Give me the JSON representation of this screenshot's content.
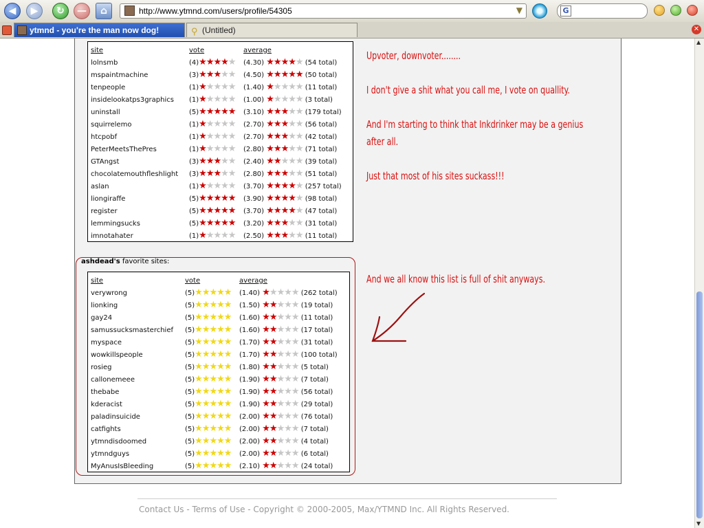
{
  "browser": {
    "url": "http://www.ytmnd.com/users/profile/54305",
    "tabs": [
      {
        "label": "ytmnd - you're the man now dog!",
        "active": true
      },
      {
        "label": "(Untitled)",
        "active": false
      }
    ],
    "search_engine_icon": "G"
  },
  "votes_table": {
    "headers": {
      "site": "site",
      "vote": "vote",
      "average": "average"
    },
    "rows": [
      {
        "site": "lolnsmb",
        "vote": 4,
        "vote_label": "(4)",
        "average": 4.3,
        "average_label": "(4.30)",
        "total": "(54 total)"
      },
      {
        "site": "mspaintmachine",
        "vote": 3,
        "vote_label": "(3)",
        "average": 4.5,
        "average_label": "(4.50)",
        "total": "(50 total)"
      },
      {
        "site": "tenpeople",
        "vote": 1,
        "vote_label": "(1)",
        "average": 1.4,
        "average_label": "(1.40)",
        "total": "(11 total)"
      },
      {
        "site": "insidelookatps3graphics",
        "vote": 1,
        "vote_label": "(1)",
        "average": 1.0,
        "average_label": "(1.00)",
        "total": "(3 total)"
      },
      {
        "site": "uninstall",
        "vote": 5,
        "vote_label": "(5)",
        "average": 3.1,
        "average_label": "(3.10)",
        "total": "(179 total)"
      },
      {
        "site": "squirrelemo",
        "vote": 1,
        "vote_label": "(1)",
        "average": 2.7,
        "average_label": "(2.70)",
        "total": "(56 total)"
      },
      {
        "site": "htcpobf",
        "vote": 1,
        "vote_label": "(1)",
        "average": 2.7,
        "average_label": "(2.70)",
        "total": "(42 total)"
      },
      {
        "site": "PeterMeetsThePres",
        "vote": 1,
        "vote_label": "(1)",
        "average": 2.8,
        "average_label": "(2.80)",
        "total": "(71 total)"
      },
      {
        "site": "GTAngst",
        "vote": 3,
        "vote_label": "(3)",
        "average": 2.4,
        "average_label": "(2.40)",
        "total": "(39 total)"
      },
      {
        "site": "chocolatemouthfleshlight",
        "vote": 3,
        "vote_label": "(3)",
        "average": 2.8,
        "average_label": "(2.80)",
        "total": "(51 total)"
      },
      {
        "site": "aslan",
        "vote": 1,
        "vote_label": "(1)",
        "average": 3.7,
        "average_label": "(3.70)",
        "total": "(257 total)"
      },
      {
        "site": "liongiraffe",
        "vote": 5,
        "vote_label": "(5)",
        "average": 3.9,
        "average_label": "(3.90)",
        "total": "(98 total)"
      },
      {
        "site": "register",
        "vote": 5,
        "vote_label": "(5)",
        "average": 3.7,
        "average_label": "(3.70)",
        "total": "(47 total)"
      },
      {
        "site": "lemmingsucks",
        "vote": 5,
        "vote_label": "(5)",
        "average": 3.2,
        "average_label": "(3.20)",
        "total": "(31 total)"
      },
      {
        "site": "imnotahater",
        "vote": 1,
        "vote_label": "(1)",
        "average": 2.5,
        "average_label": "(2.50)",
        "total": "(11 total)"
      }
    ]
  },
  "favorites": {
    "owner": "ashdead's",
    "heading_suffix": " favorite sites:",
    "headers": {
      "site": "site",
      "vote": "vote",
      "average": "average"
    },
    "rows": [
      {
        "site": "verywrong",
        "vote": 5,
        "vote_label": "(5)",
        "average": 1.4,
        "average_label": "(1.40)",
        "total": "(262 total)"
      },
      {
        "site": "lionking",
        "vote": 5,
        "vote_label": "(5)",
        "average": 1.5,
        "average_label": "(1.50)",
        "total": "(19 total)"
      },
      {
        "site": "gay24",
        "vote": 5,
        "vote_label": "(5)",
        "average": 1.6,
        "average_label": "(1.60)",
        "total": "(11 total)"
      },
      {
        "site": "samussucksmasterchief",
        "vote": 5,
        "vote_label": "(5)",
        "average": 1.6,
        "average_label": "(1.60)",
        "total": "(17 total)"
      },
      {
        "site": "myspace",
        "vote": 5,
        "vote_label": "(5)",
        "average": 1.7,
        "average_label": "(1.70)",
        "total": "(31 total)"
      },
      {
        "site": "wowkillspeople",
        "vote": 5,
        "vote_label": "(5)",
        "average": 1.7,
        "average_label": "(1.70)",
        "total": "(100 total)"
      },
      {
        "site": "rosieg",
        "vote": 5,
        "vote_label": "(5)",
        "average": 1.8,
        "average_label": "(1.80)",
        "total": "(5 total)"
      },
      {
        "site": "callonemeee",
        "vote": 5,
        "vote_label": "(5)",
        "average": 1.9,
        "average_label": "(1.90)",
        "total": "(7 total)"
      },
      {
        "site": "thebabe",
        "vote": 5,
        "vote_label": "(5)",
        "average": 1.9,
        "average_label": "(1.90)",
        "total": "(56 total)"
      },
      {
        "site": "kderacist",
        "vote": 5,
        "vote_label": "(5)",
        "average": 1.9,
        "average_label": "(1.90)",
        "total": "(29 total)"
      },
      {
        "site": "paladinsuicide",
        "vote": 5,
        "vote_label": "(5)",
        "average": 2.0,
        "average_label": "(2.00)",
        "total": "(76 total)"
      },
      {
        "site": "catfights",
        "vote": 5,
        "vote_label": "(5)",
        "average": 2.0,
        "average_label": "(2.00)",
        "total": "(7 total)"
      },
      {
        "site": "ytmndisdoomed",
        "vote": 5,
        "vote_label": "(5)",
        "average": 2.0,
        "average_label": "(2.00)",
        "total": "(4 total)"
      },
      {
        "site": "ytmndguys",
        "vote": 5,
        "vote_label": "(5)",
        "average": 2.0,
        "average_label": "(2.00)",
        "total": "(6 total)"
      },
      {
        "site": "MyAnusIsBleeding",
        "vote": 5,
        "vote_label": "(5)",
        "average": 2.1,
        "average_label": "(2.10)",
        "total": "(24 total)"
      }
    ]
  },
  "comments": {
    "line1": "Upvoter, downvoter........",
    "line2": "I don't give a shit what you call me, I vote on quallity.",
    "line3": "And I'm starting to think that Inkdrinker may be a genius",
    "line4": "after all.",
    "line5": "Just that most of his sites suckass!!!",
    "line6": "And we all know this list is full of shit anyways."
  },
  "footer": {
    "text": "Contact Us - Terms of Use - Copyright © 2000-2005, Max/YTMND Inc. All Rights Reserved."
  },
  "colors": {
    "comment_red": "#d81010",
    "star_red": "#cc0000",
    "star_yellow": "#f0d81a",
    "star_gray": "#c6c6c6",
    "favorites_border": "#b01818",
    "arrow": "#9c1010"
  }
}
